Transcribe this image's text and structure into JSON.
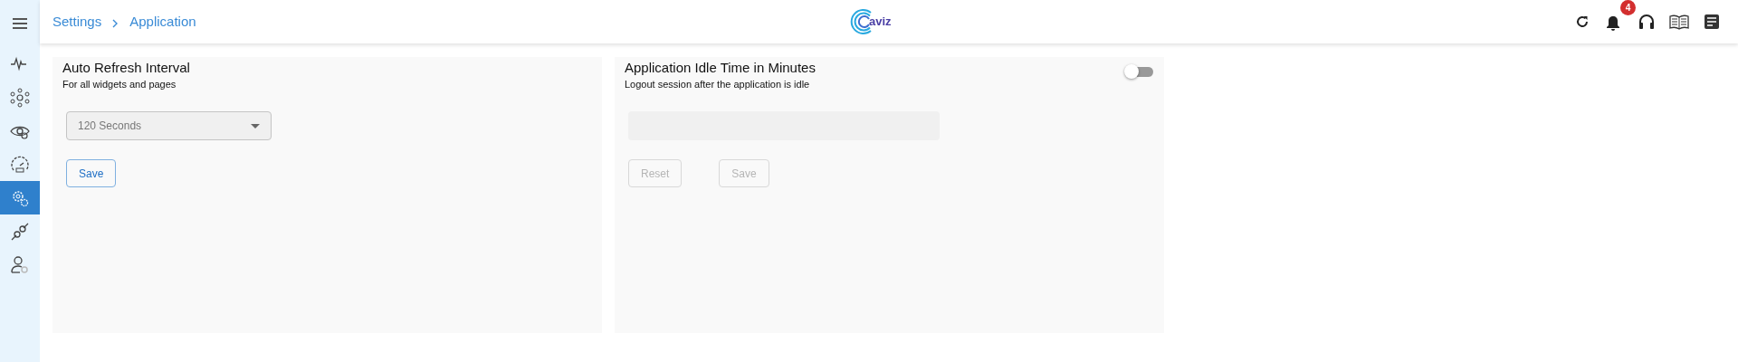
{
  "sidebar": {
    "items": [
      {
        "selected": false
      },
      {
        "selected": false
      },
      {
        "selected": false
      },
      {
        "selected": false
      },
      {
        "selected": true
      },
      {
        "selected": false
      },
      {
        "selected": false
      }
    ]
  },
  "breadcrumb": [
    "Settings",
    "Application"
  ],
  "logo": {
    "text": "aviz"
  },
  "header_actions": {
    "notifications_count": "4"
  },
  "cards": [
    {
      "title": "Auto Refresh Interval",
      "subtitle": "For all widgets and pages",
      "field": {
        "kind": "select",
        "value": "120 Seconds",
        "disabled": true
      },
      "buttons": [
        {
          "label": "Save",
          "disabled": false
        }
      ]
    },
    {
      "title": "Application Idle Time in Minutes",
      "subtitle": "Logout session after the application is idle",
      "toggle": {
        "on": false
      },
      "field": {
        "kind": "input",
        "disabled": true
      },
      "buttons": [
        {
          "label": "Reset",
          "disabled": true
        },
        {
          "label": "Save",
          "disabled": true
        }
      ]
    }
  ]
}
